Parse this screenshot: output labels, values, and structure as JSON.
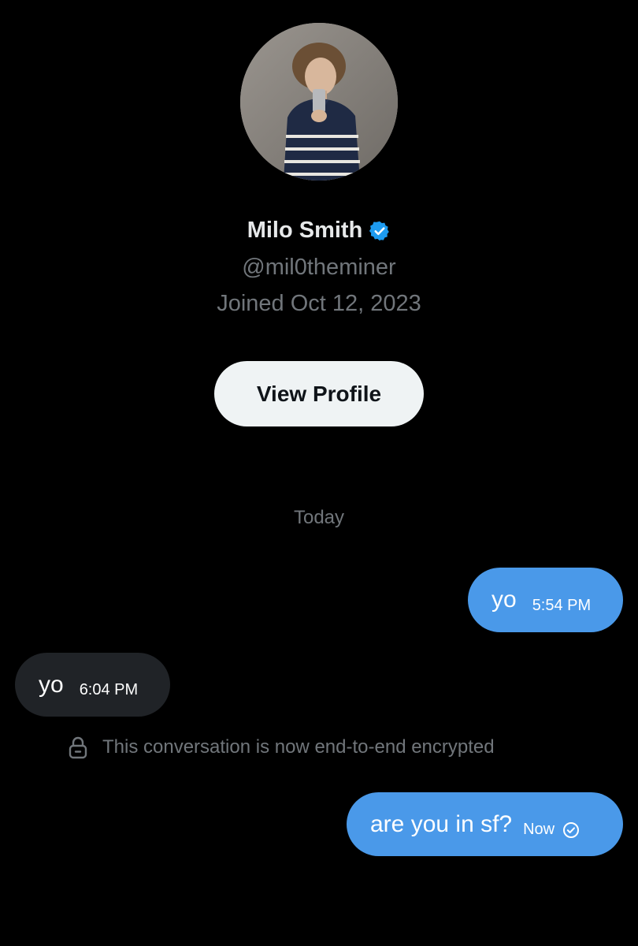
{
  "profile": {
    "name": "Milo Smith",
    "handle": "@mil0theminer",
    "joined": "Joined Oct 12, 2023",
    "view_profile_label": "View Profile",
    "verified_icon": "verified-badge-icon"
  },
  "conversation": {
    "date_separator": "Today",
    "messages": [
      {
        "direction": "sent",
        "text": "yo",
        "time": "5:54 PM"
      },
      {
        "direction": "received",
        "text": "yo",
        "time": "6:04 PM"
      },
      {
        "direction": "sent",
        "text": "are you in sf?",
        "time": "Now",
        "status_icon": "read-check-icon"
      }
    ],
    "encryption_notice": "This conversation is now end-to-end encrypted"
  },
  "colors": {
    "background": "#000000",
    "sent_bubble": "#4a99e9",
    "received_bubble": "#202327",
    "muted_text": "#71767b",
    "verified_blue": "#1d9bf0",
    "button_bg": "#eff3f4"
  }
}
